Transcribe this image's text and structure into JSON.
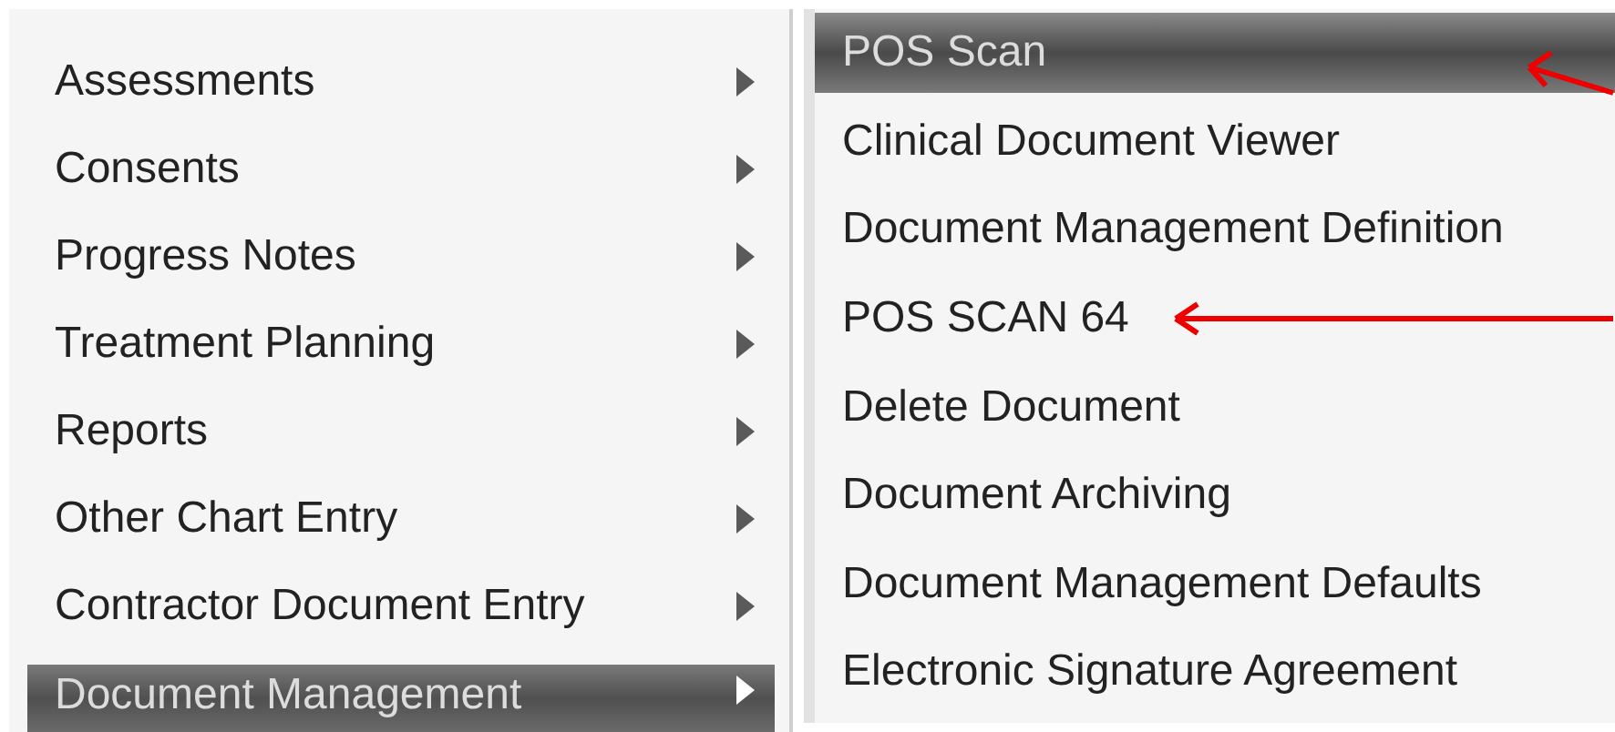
{
  "menu": {
    "items": [
      {
        "label": "Assessments",
        "has_submenu": true,
        "selected": false
      },
      {
        "label": "Consents",
        "has_submenu": true,
        "selected": false
      },
      {
        "label": "Progress Notes",
        "has_submenu": true,
        "selected": false
      },
      {
        "label": "Treatment Planning",
        "has_submenu": true,
        "selected": false
      },
      {
        "label": "Reports",
        "has_submenu": true,
        "selected": false
      },
      {
        "label": "Other Chart Entry",
        "has_submenu": true,
        "selected": false
      },
      {
        "label": "Contractor Document Entry",
        "has_submenu": true,
        "selected": false
      },
      {
        "label": "Document Management",
        "has_submenu": true,
        "selected": true
      }
    ]
  },
  "submenu": {
    "items": [
      {
        "label": "POS Scan",
        "selected": true,
        "kind": "angled"
      },
      {
        "label": "Clinical Document Viewer",
        "selected": false,
        "kind": "plain"
      },
      {
        "label": "Document Management Definition",
        "selected": false,
        "kind": "plain"
      },
      {
        "label": "POS SCAN 64",
        "selected": false,
        "kind": "straight"
      },
      {
        "label": "Delete Document",
        "selected": false,
        "kind": "plain"
      },
      {
        "label": "Document Archiving",
        "selected": false,
        "kind": "plain"
      },
      {
        "label": "Document Management Defaults",
        "selected": false,
        "kind": "plain"
      },
      {
        "label": "Electronic Signature Agreement",
        "selected": false,
        "kind": "plain"
      }
    ]
  }
}
